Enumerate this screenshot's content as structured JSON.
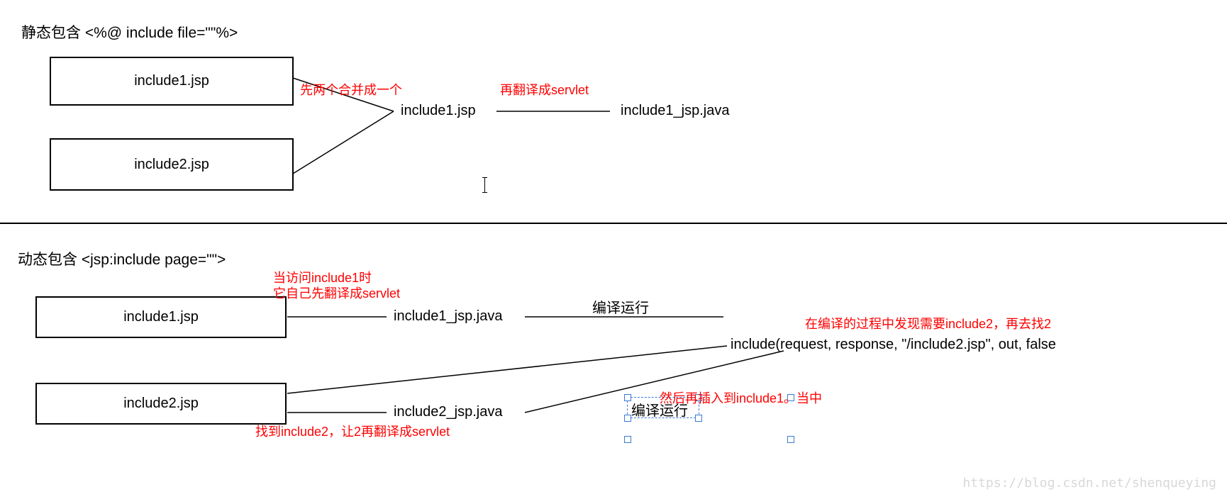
{
  "static": {
    "title": "静态包含  <%@ include file=\"\"%>",
    "box1": "include1.jsp",
    "box2": "include2.jsp",
    "merged": "include1.jsp",
    "servlet": "include1_jsp.java",
    "mergeNote": "先两个合并成一个",
    "translateNote": "再翻译成servlet"
  },
  "dynamic": {
    "title": "动态包含   <jsp:include page=\"\">",
    "box1": "include1.jsp",
    "box2": "include2.jsp",
    "servlet1": "include1_jsp.java",
    "servlet2": "include2_jsp.java",
    "includeCall": "include(request, response, \"/include2.jsp\", out, false",
    "compileRun1": "编译运行",
    "compileRun2": "编译运行",
    "note1Line1": "当访问include1时",
    "note1Line2": "它自己先翻译成servlet",
    "note2": "在编译的过程中发现需要include2，再去找2",
    "note3": "找到include2，让2再翻译成servlet",
    "note4": "然后再插入到include1。当中"
  },
  "watermark": "https://blog.csdn.net/shenqueying"
}
